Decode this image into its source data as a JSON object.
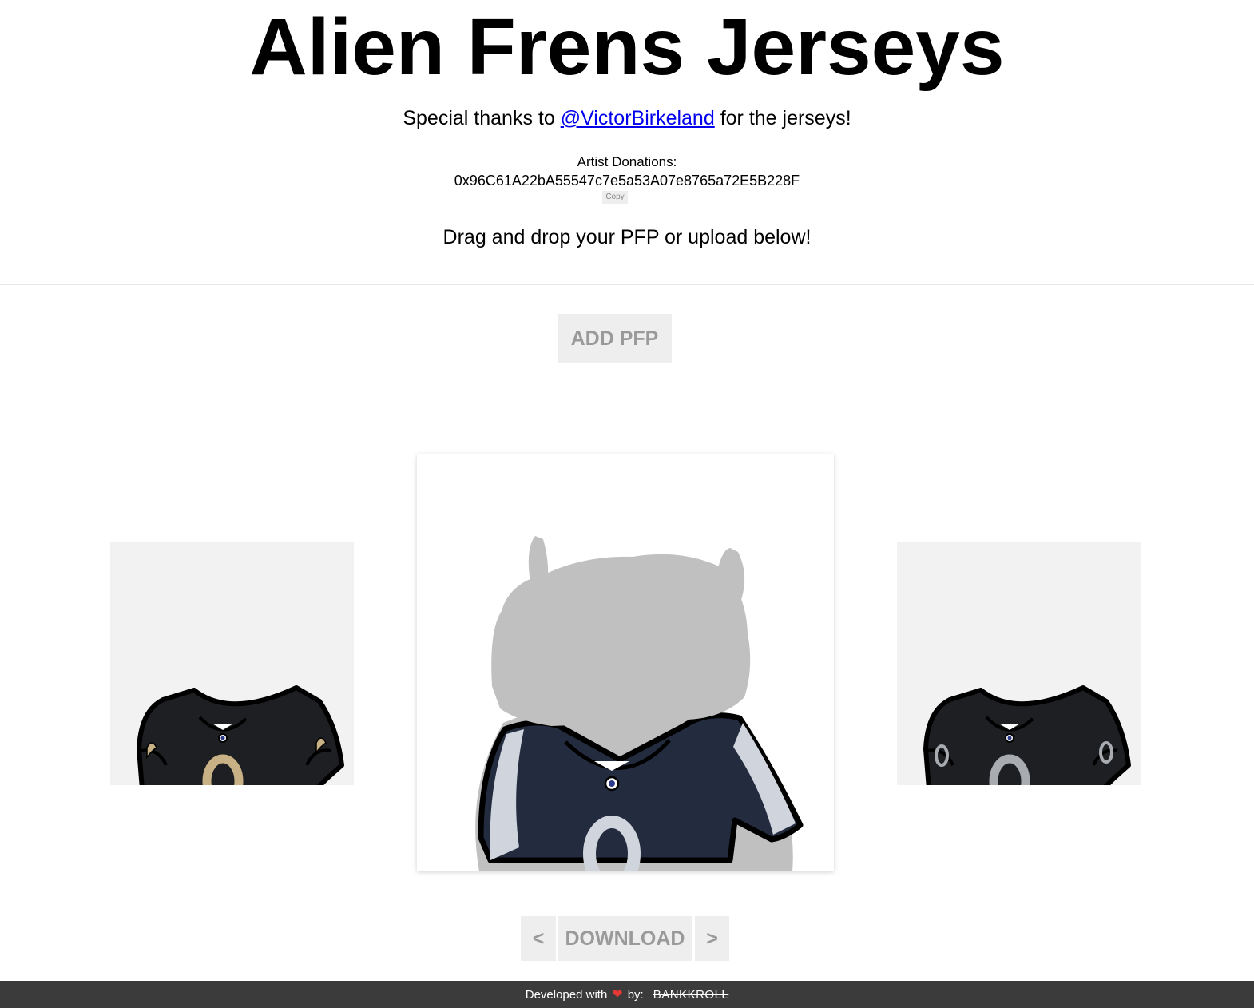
{
  "header": {
    "title": "Alien Frens Jerseys",
    "thanks_prefix": "Special thanks to ",
    "thanks_link": "@VictorBirkeland",
    "thanks_suffix": " for the jerseys!",
    "donation_label": "Artist Donations:",
    "donation_address": "0x96C61A22bA55547c7e5a53A07e8765a72E5B228F",
    "copy_label": "Copy",
    "instructions": "Drag and drop your PFP or upload below!"
  },
  "actions": {
    "add_pfp_label": "ADD PFP",
    "prev_label": "<",
    "download_label": "DOWNLOAD",
    "next_label": ">"
  },
  "carousel": {
    "left_jersey": {
      "body": "#1e1f22",
      "trim": "#ffffff",
      "number": "0",
      "number_color": "#c8b184",
      "sleeve_logo": "fleur-de-lis"
    },
    "center_jersey": {
      "body": "#232b3e",
      "sleeve": "#cfd4dd",
      "number": "0",
      "number_color": "#cfd4dd",
      "head_color": "#c0c0c0"
    },
    "right_jersey": {
      "body": "#1e1f22",
      "number": "0",
      "number_color": "#a8acb0",
      "sleeve_number": "0"
    }
  },
  "footer": {
    "prefix": "Developed with",
    "by": "by:",
    "brand": "BANKKROLL"
  }
}
